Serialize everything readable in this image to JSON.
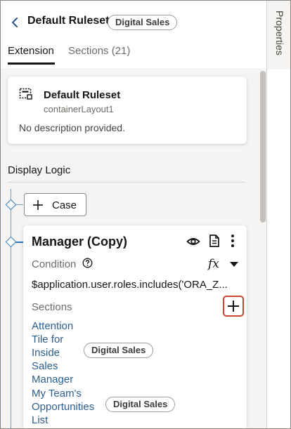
{
  "header": {
    "back_icon": "chevron-left-icon",
    "title": "Default Ruleset",
    "badge": "Digital Sales"
  },
  "tabs": [
    {
      "label": "Extension",
      "active": true
    },
    {
      "label": "Sections (21)",
      "active": false
    }
  ],
  "summary_card": {
    "icon": "layout-icon",
    "title": "Default Ruleset",
    "subtitle": "containerLayout1",
    "description": "No description provided."
  },
  "display_logic": {
    "heading": "Display Logic",
    "case_button": "Case",
    "rule": {
      "title": "Manager (Copy)",
      "condition_label": "Condition",
      "fx_label": "fx",
      "condition_expression": "$application.user.roles.includes('ORA_Z...",
      "sections_label": "Sections",
      "sections": [
        {
          "name": "Attention Tile for Inside Sales Manager",
          "badge": ""
        },
        {
          "name": "My Team's Opportunities List",
          "badge": ""
        }
      ],
      "section_badges": [
        "Digital Sales",
        "Digital Sales"
      ]
    }
  },
  "rail": {
    "label": "Properties"
  },
  "colors": {
    "accent_blue": "#2e78b2",
    "link": "#2c5e8f",
    "highlight_red": "#c74634"
  }
}
